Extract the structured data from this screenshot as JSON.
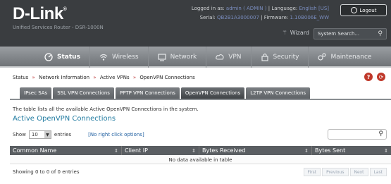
{
  "header": {
    "logo": "D-Link",
    "logo_reg": "®",
    "subtitle": "Unified Services Router - DSR-1000N",
    "logged_in_label": "Logged in as:",
    "logged_in_value": "admin ( ADMIN )",
    "language_label": "Language:",
    "language_value": "English [US]",
    "serial_label": "Serial:",
    "serial_value": "QB2B1A3000007",
    "firmware_label": "Firmware:",
    "firmware_value": "1.10B006E_WW",
    "logout_label": "Logout",
    "wizard_label": "Wizard",
    "search_placeholder": "System Search..."
  },
  "nav": {
    "items": [
      {
        "label": "Status"
      },
      {
        "label": "Wireless"
      },
      {
        "label": "Network"
      },
      {
        "label": "VPN"
      },
      {
        "label": "Security"
      },
      {
        "label": "Maintenance"
      }
    ]
  },
  "breadcrumb": {
    "items": [
      "Status",
      "Network Information",
      "Active VPNs",
      "OpenVPN Connections"
    ],
    "separator": "»"
  },
  "tabs": [
    {
      "label": "IPsec SAs"
    },
    {
      "label": "SSL VPN Connections"
    },
    {
      "label": "PPTP VPN Connections"
    },
    {
      "label": "OpenVPN Connections"
    },
    {
      "label": "L2TP VPN Connections"
    }
  ],
  "page": {
    "description": "The table lists all the available Active OpenVPN Connections in the system.",
    "section_title": "Active OpenVPN Connections"
  },
  "table": {
    "show_label": "Show",
    "page_size": "10",
    "entries_label": "entries",
    "right_click_label": "[No right click options]",
    "columns": [
      "Common Name",
      "Client IP",
      "Bytes Received",
      "Bytes Sent"
    ],
    "empty_message": "No data available in table",
    "info": "Showing 0 to 0 of 0 entries",
    "pager": [
      "First",
      "Previous",
      "Next",
      "Last"
    ]
  }
}
